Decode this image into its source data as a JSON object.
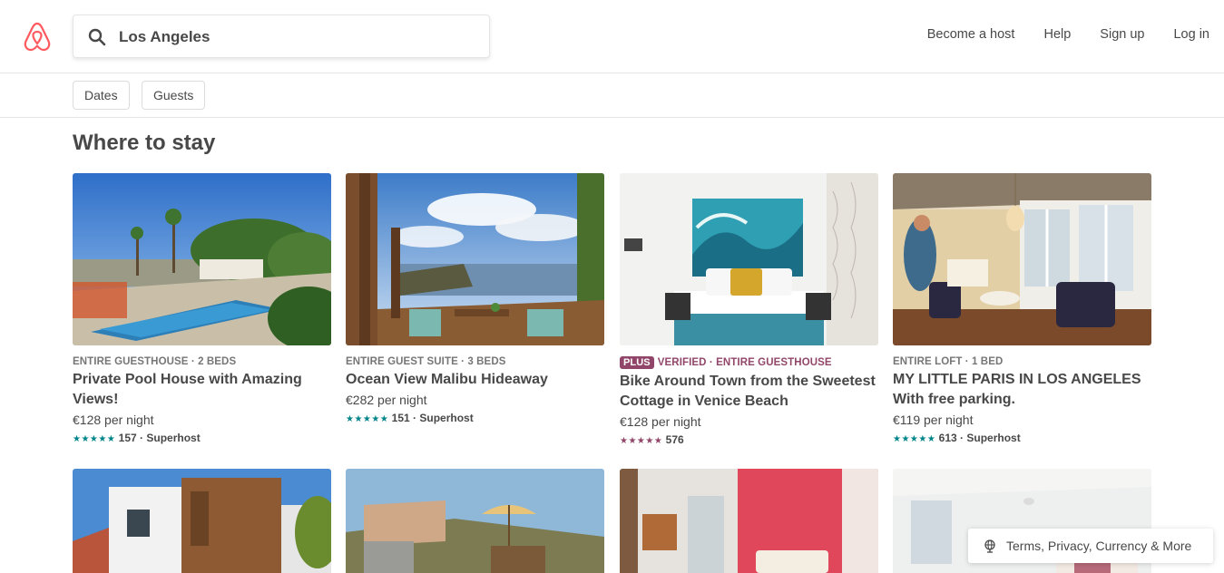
{
  "header": {
    "brand_color": "#FF5A5F",
    "logo_icon": "airbnb-belo-icon",
    "search": {
      "value": "Los Angeles",
      "icon": "search-icon"
    },
    "nav": [
      "Become a host",
      "Help",
      "Sign up",
      "Log in"
    ]
  },
  "filters": [
    "Dates",
    "Guests"
  ],
  "section_title": "Where to stay",
  "listings": [
    {
      "kicker": "ENTIRE GUESTHOUSE · 2 BEDS",
      "name": "Private Pool House with Amazing Views!",
      "price": "€128 per night",
      "stars": "★★★★★",
      "rating": "157 · Superhost"
    },
    {
      "kicker": "ENTIRE GUEST SUITE · 3 BEDS",
      "name": "Ocean View Malibu Hideaway",
      "price": "€282 per night",
      "stars": "★★★★★",
      "rating": "151 · Superhost"
    },
    {
      "badge": "PLUS",
      "kicker": "VERIFIED · ENTIRE GUESTHOUSE",
      "name": "Bike Around Town from the Sweetest Cottage in Venice Beach",
      "price": "€128 per night",
      "stars": "★★★★★",
      "rating": "576"
    },
    {
      "kicker": "ENTIRE LOFT · 1 BED",
      "name": "MY LITTLE PARIS IN LOS ANGELES With free parking.",
      "price": "€119 per night",
      "stars": "★★★★★",
      "rating": "613 · Superhost"
    }
  ],
  "footer_button": {
    "label": "Terms, Privacy, Currency & More",
    "icon": "globe-icon"
  },
  "colors": {
    "accent_teal": "#008489",
    "plus_purple": "#914669",
    "text": "#484848"
  }
}
